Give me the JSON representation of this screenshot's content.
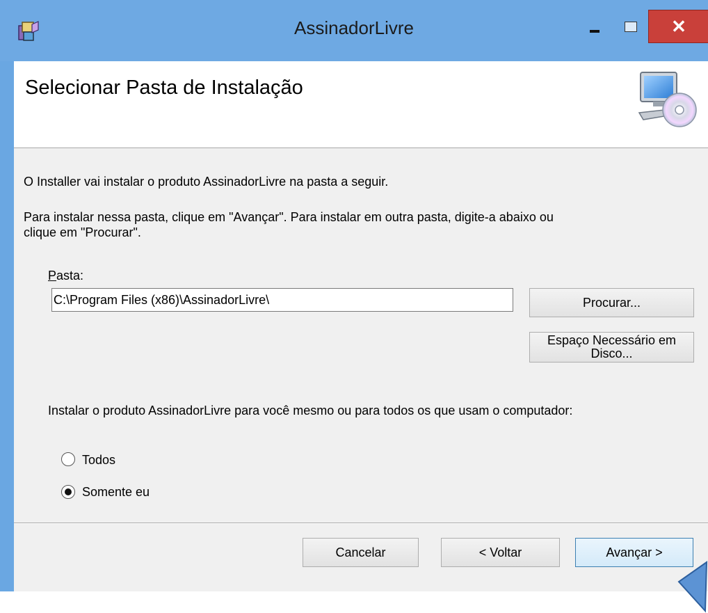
{
  "window": {
    "title": "AssinadorLivre",
    "minimize_label": "",
    "close_label": "✕"
  },
  "header": {
    "title": "Selecionar Pasta de Instalação"
  },
  "body": {
    "intro": "O Installer vai instalar o produto AssinadorLivre na pasta a seguir.",
    "instruction_line1": "Para instalar nessa pasta, clique em \"Avançar\". Para instalar em outra pasta, digite-a abaixo ou",
    "instruction_line2": "clique em \"Procurar\".",
    "folder_label_accel": "P",
    "folder_label_rest": "asta:",
    "folder_value": "C:\\Program Files (x86)\\AssinadorLivre\\",
    "browse_label": "Procurar...",
    "disk_cost_line1": "Espaço Necessário em",
    "disk_cost_line2": "Disco...",
    "scope_question": "Instalar o produto AssinadorLivre para você mesmo ou para todos os que usam o computador:",
    "radio_everyone": "Todos",
    "radio_just_me": "Somente eu",
    "selected": "Somente eu"
  },
  "footer": {
    "cancel_label": "Cancelar",
    "back_label": "< Voltar",
    "next_label": "Avançar >"
  },
  "colors": {
    "titlebar": "#6ea9e3",
    "close_button": "#c9403a",
    "panel": "#f0f0f0"
  },
  "icons": {
    "app": "installer-package-icon",
    "header": "computer-cd-icon"
  }
}
